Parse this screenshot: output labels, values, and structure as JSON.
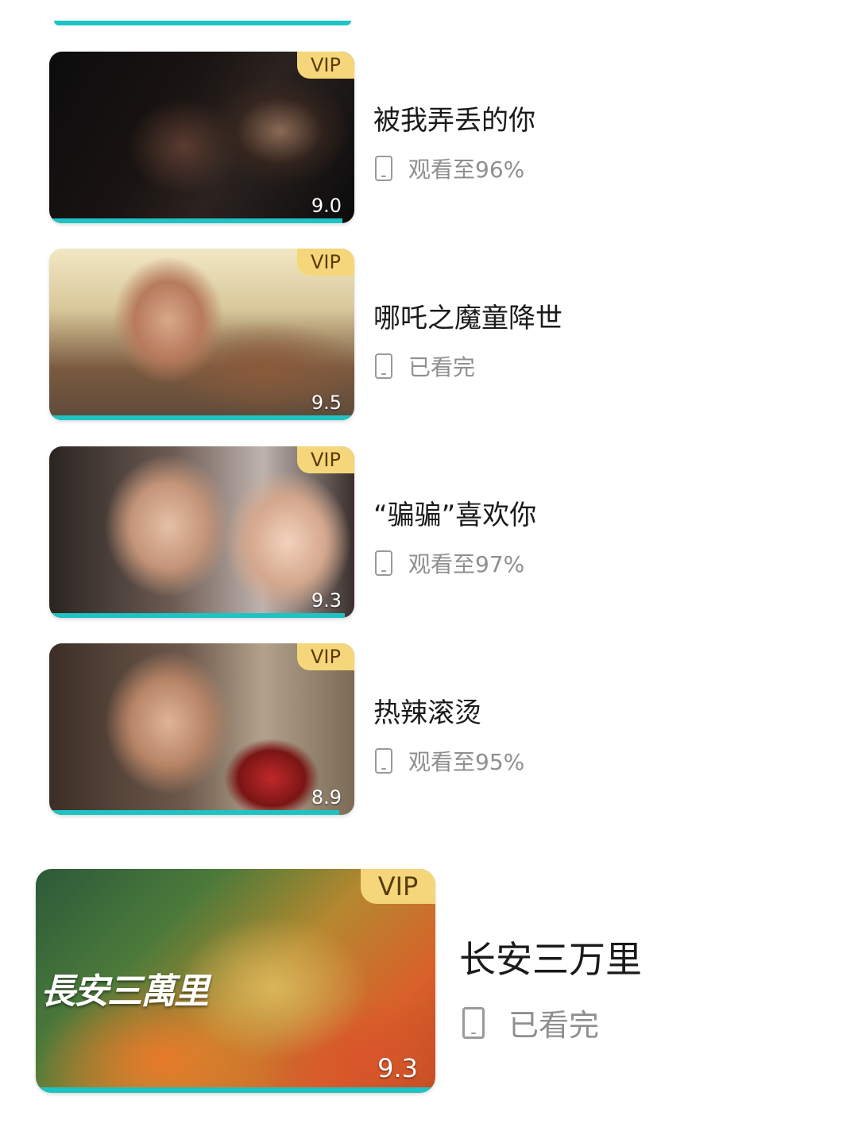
{
  "items": [
    {
      "title": "被我弄丢的你",
      "status": "观看至96%",
      "score": "9.0",
      "badge": "VIP",
      "progress_percent": 96
    },
    {
      "title": "哪吒之魔童降世",
      "status": "已看完",
      "score": "9.5",
      "badge": "VIP",
      "progress_percent": 100
    },
    {
      "title": "“骗骗”喜欢你",
      "status": "观看至97%",
      "score": "9.3",
      "badge": "VIP",
      "progress_percent": 97
    },
    {
      "title": "热辣滚烫",
      "status": "观看至95%",
      "score": "8.9",
      "badge": "VIP",
      "progress_percent": 95
    },
    {
      "title": "长安三万里",
      "status": "已看完",
      "score": "9.3",
      "badge": "VIP",
      "progress_percent": 100,
      "poster_text": "長安三萬里"
    }
  ],
  "icons": {
    "status_icon": "phone-icon"
  },
  "colors": {
    "progress": "#1ec3c3",
    "vip_bg": "#f5d67a",
    "status_text": "#8f8f8f"
  }
}
